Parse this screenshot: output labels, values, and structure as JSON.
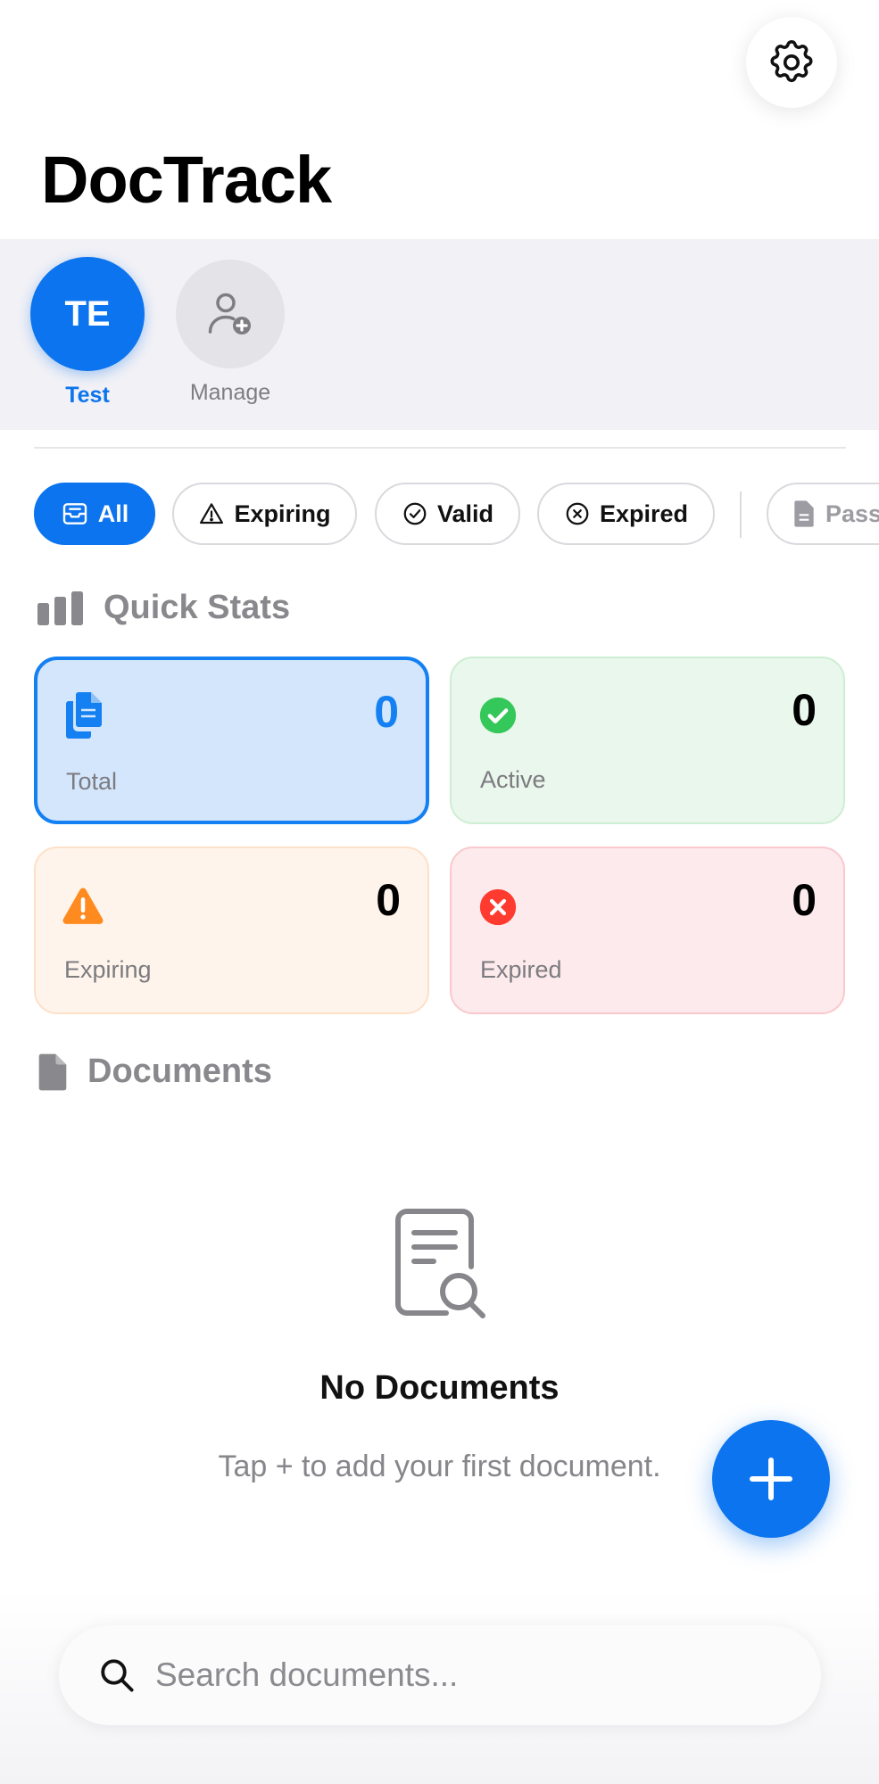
{
  "app": {
    "title": "DocTrack"
  },
  "header": {
    "settings_icon": "gear-icon"
  },
  "profiles": [
    {
      "initials": "TE",
      "name": "Test",
      "selected": true
    },
    {
      "name": "Manage",
      "icon": "add-person-icon"
    }
  ],
  "filters": [
    {
      "label": "All",
      "icon": "tray-icon",
      "active": true
    },
    {
      "label": "Expiring",
      "icon": "warning-triangle-icon"
    },
    {
      "label": "Valid",
      "icon": "checkmark-circle-icon"
    },
    {
      "label": "Expired",
      "icon": "x-circle-icon"
    },
    {
      "label": "Pass",
      "icon": "document-icon"
    }
  ],
  "quick_stats": {
    "title": "Quick Stats",
    "cards": [
      {
        "label": "Total",
        "value": "0",
        "color": "#1480f2"
      },
      {
        "label": "Active",
        "value": "0",
        "color": "#34c759"
      },
      {
        "label": "Expiring",
        "value": "0",
        "color": "#ff8a1f"
      },
      {
        "label": "Expired",
        "value": "0",
        "color": "#ff3b30"
      }
    ]
  },
  "documents": {
    "title": "Documents",
    "empty_title": "No Documents",
    "empty_subtitle": "Tap + to add your first document."
  },
  "fab": {
    "icon": "plus-icon"
  },
  "search": {
    "placeholder": "Search documents...",
    "value": ""
  },
  "colors": {
    "accent": "#0b74ee"
  }
}
